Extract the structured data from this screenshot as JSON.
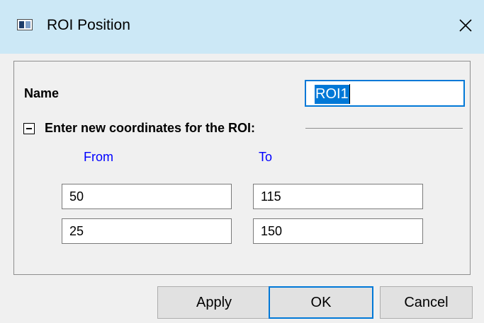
{
  "window": {
    "title": "ROI Position",
    "icon": "app-window-icon",
    "close_icon": "close-icon"
  },
  "form": {
    "name_label": "Name",
    "name_value": "ROI1",
    "group_label": "Enter new coordinates for the ROI:",
    "from_label": "From",
    "to_label": "To",
    "rows": [
      {
        "from": "50",
        "to": "115"
      },
      {
        "from": "25",
        "to": "150"
      }
    ]
  },
  "buttons": {
    "apply": "Apply",
    "ok": "OK",
    "cancel": "Cancel"
  },
  "colors": {
    "titlebar": "#cce8f6",
    "accent": "#0078d7",
    "column_header": "#0000ff"
  }
}
